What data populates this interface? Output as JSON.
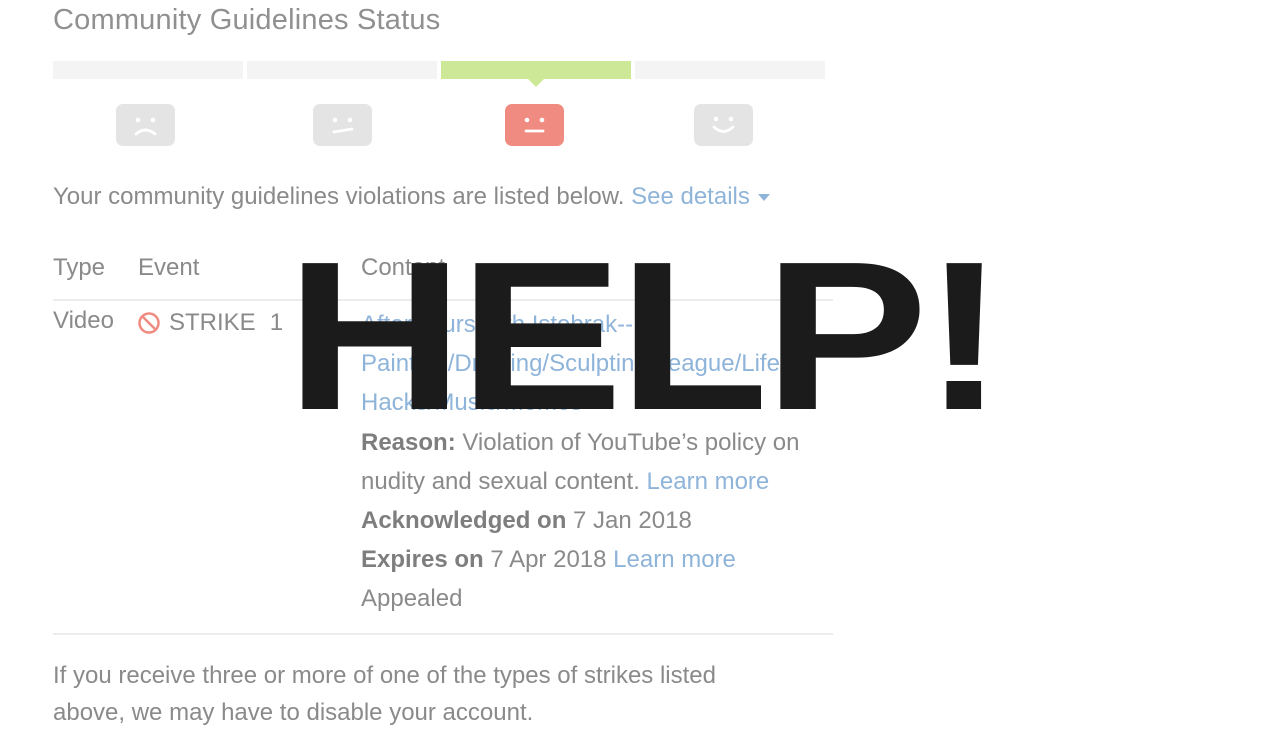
{
  "page": {
    "title": "Community Guidelines Status"
  },
  "status": {
    "levels": 4,
    "active_index": 2,
    "faces": [
      "sad-face-icon",
      "unhappy-face-icon",
      "neutral-face-icon",
      "happy-face-icon"
    ],
    "colors": {
      "inactive": "#e4e4e4",
      "active_face": "#ef8b80",
      "active_bar": "#cde997"
    }
  },
  "intro": {
    "text": "Your community guidelines violations are listed below.",
    "see_details": "See details"
  },
  "table": {
    "headers": {
      "type": "Type",
      "event": "Event",
      "content": "Content"
    },
    "row": {
      "type": "Video",
      "event_label": "STRIKE",
      "event_count": "1",
      "content_title_line1": "AfterHours with Istebrak--",
      "content_title_line2": "Painting/Drawing/Sculpting League/Life",
      "content_title_line3": "Hacks/Music/Memes",
      "reason_label": "Reason:",
      "reason_text_line1": " Violation of YouTube’s policy on",
      "reason_text_line2": "nudity and sexual content.",
      "learn_more_1": "Learn more",
      "acknowledged_label": "Acknowledged on",
      "acknowledged_date": " 7 Jan 2018",
      "expires_label": "Expires on",
      "expires_date": " 7 Apr 2018",
      "learn_more_2": "Learn more",
      "appealed": "Appealed"
    }
  },
  "footer": {
    "line1": "If you receive three or more of one of the types of strikes listed",
    "line2": "above, we may have to disable your account."
  },
  "overlay": {
    "text": "HELP!"
  }
}
